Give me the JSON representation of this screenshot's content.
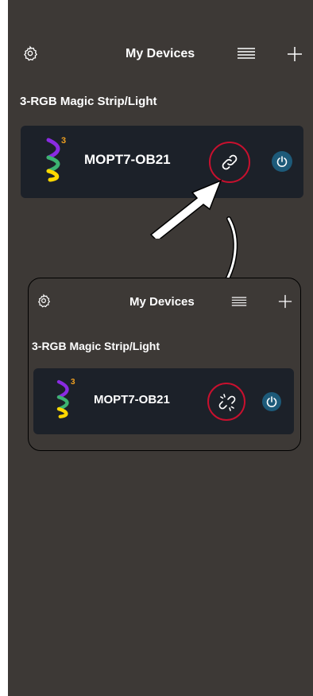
{
  "header": {
    "title": "My Devices"
  },
  "category": {
    "label": "3-RGB Magic Strip/Light"
  },
  "device": {
    "name": "MOPT7-OB21",
    "badge": "3"
  },
  "inset": {
    "header": {
      "title": "My Devices"
    },
    "category": {
      "label": "3-RGB Magic Strip/Light"
    },
    "device": {
      "name": "MOPT7-OB21",
      "badge": "3"
    }
  },
  "icons": {
    "settings": "gear-icon",
    "list": "list-icon",
    "add": "plus-icon",
    "link": "link-icon",
    "unlink": "broken-link-icon",
    "power": "power-icon"
  },
  "colors": {
    "background": "#3d3936",
    "card": "#1c2129",
    "highlight": "#c8102e",
    "power": "#1d5a79"
  }
}
